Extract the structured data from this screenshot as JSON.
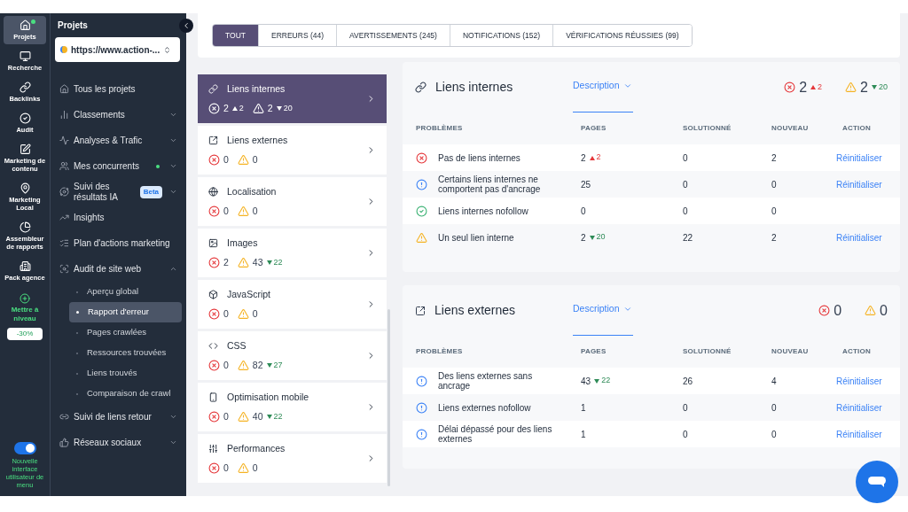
{
  "rail": {
    "items": [
      {
        "label": "Projets",
        "selected": true,
        "notification": true,
        "kind": "nav"
      },
      {
        "label": "Recherche",
        "selected": false,
        "notification": false,
        "kind": "nav"
      },
      {
        "label": "Backlinks",
        "selected": false,
        "notification": false,
        "kind": "nav"
      },
      {
        "label": "Audit",
        "selected": false,
        "notification": false,
        "kind": "nav"
      },
      {
        "label": "Marketing de contenu",
        "selected": false,
        "notification": false,
        "kind": "nav"
      },
      {
        "label": "Marketing Local",
        "selected": false,
        "notification": false,
        "kind": "nav"
      },
      {
        "label": "Assembleur de rapports",
        "selected": false,
        "notification": false,
        "kind": "nav"
      },
      {
        "label": "Pack agence",
        "selected": false,
        "notification": false,
        "kind": "nav"
      },
      {
        "label": "Mettre à niveau",
        "selected": false,
        "notification": false,
        "kind": "upgrade"
      }
    ],
    "discount": "-30%",
    "toggle": {
      "on": true,
      "label": "Nouvelle interface utilisateur de menu"
    }
  },
  "nav": {
    "title": "Projets",
    "project": "https://www.action-...",
    "items": [
      {
        "label": "Tous les projets"
      },
      {
        "label": "Classements",
        "expanded": false
      },
      {
        "label": "Analyses & Trafic",
        "expanded": false
      },
      {
        "label": "Mes concurrents",
        "expanded": false,
        "dot": true
      },
      {
        "label": "Suivi des résultats IA",
        "expanded": false,
        "badge": "Beta"
      },
      {
        "label": "Insights"
      },
      {
        "label": "Plan d'actions marketing"
      },
      {
        "label": "Audit de site web",
        "expanded": true,
        "children": [
          {
            "label": "Aperçu global",
            "selected": false
          },
          {
            "label": "Rapport d'erreur",
            "selected": true
          },
          {
            "label": "Pages crawlées",
            "selected": false
          },
          {
            "label": "Ressources trouvées",
            "selected": false
          },
          {
            "label": "Liens trouvés",
            "selected": false
          },
          {
            "label": "Comparaison de crawl",
            "selected": false
          }
        ]
      },
      {
        "label": "Suivi de liens retour",
        "expanded": false
      },
      {
        "label": "Réseaux sociaux",
        "expanded": false
      }
    ]
  },
  "tabs": [
    {
      "label": "TOUT",
      "selected": true
    },
    {
      "label": "ERREURS (44)",
      "selected": false
    },
    {
      "label": "AVERTISSEMENTS (245)",
      "selected": false
    },
    {
      "label": "NOTIFICATIONS (152)",
      "selected": false
    },
    {
      "label": "VÉRIFICATIONS RÉUSSIES (99)",
      "selected": false
    }
  ],
  "categories": [
    {
      "name": "Liens internes",
      "selected": true,
      "errors": "2",
      "errors_delta": {
        "kind": "up",
        "value": "2"
      },
      "warnings": "2",
      "warnings_delta": {
        "kind": "down",
        "value": "20"
      }
    },
    {
      "name": "Liens externes",
      "selected": false,
      "errors": "0",
      "warnings": "0"
    },
    {
      "name": "Localisation",
      "selected": false,
      "errors": "0",
      "warnings": "0"
    },
    {
      "name": "Images",
      "selected": false,
      "errors": "2",
      "warnings": "43",
      "warnings_delta": {
        "kind": "down",
        "value": "22"
      }
    },
    {
      "name": "JavaScript",
      "selected": false,
      "errors": "0",
      "warnings": "0"
    },
    {
      "name": "CSS",
      "selected": false,
      "errors": "0",
      "warnings": "82",
      "warnings_delta": {
        "kind": "down",
        "value": "27"
      }
    },
    {
      "name": "Optimisation mobile",
      "selected": false,
      "errors": "0",
      "warnings": "40",
      "warnings_delta": {
        "kind": "down",
        "value": "22"
      }
    },
    {
      "name": "Performances",
      "selected": false,
      "errors": "0",
      "warnings": "0"
    }
  ],
  "sections": [
    {
      "title": "Liens internes",
      "description": "Description",
      "errors": "2",
      "errors_delta": {
        "kind": "up",
        "value": "2"
      },
      "warnings": "2",
      "warnings_delta": {
        "kind": "down",
        "value": "20"
      },
      "columns": [
        "PROBLÈMES",
        "PAGES",
        "SOLUTIONNÉ",
        "NOUVEAU",
        "ACTION"
      ],
      "rows": [
        {
          "kind": "error",
          "problem": "Pas de liens internes",
          "pages": "2",
          "pages_delta": {
            "kind": "up",
            "value": "2"
          },
          "solved": "0",
          "new": "2",
          "action": "Réinitialiser"
        },
        {
          "kind": "info",
          "problem": "Certains liens internes ne comportent pas d'ancrage",
          "pages": "25",
          "solved": "0",
          "new": "0",
          "action": "Réinitialiser"
        },
        {
          "kind": "ok",
          "problem": "Liens internes nofollow",
          "pages": "0",
          "solved": "0",
          "new": "0"
        },
        {
          "kind": "warning",
          "problem": "Un seul lien interne",
          "pages": "2",
          "pages_delta": {
            "kind": "down",
            "value": "20"
          },
          "solved": "22",
          "new": "2",
          "action": "Réinitialiser"
        }
      ]
    },
    {
      "title": "Liens externes",
      "description": "Description",
      "errors": "0",
      "warnings": "0",
      "columns": [
        "PROBLÈMES",
        "PAGES",
        "SOLUTIONNÉ",
        "NOUVEAU",
        "ACTION"
      ],
      "rows": [
        {
          "kind": "info",
          "problem": "Des liens externes sans ancrage",
          "pages": "43",
          "pages_delta": {
            "kind": "down",
            "value": "22"
          },
          "solved": "26",
          "new": "4",
          "action": "Réinitialiser"
        },
        {
          "kind": "info",
          "problem": "Liens externes nofollow",
          "pages": "1",
          "solved": "0",
          "new": "0",
          "action": "Réinitialiser"
        },
        {
          "kind": "info",
          "problem": "Délai dépassé pour des liens externes",
          "pages": "1",
          "solved": "0",
          "new": "0",
          "action": "Réinitialiser"
        }
      ]
    }
  ]
}
